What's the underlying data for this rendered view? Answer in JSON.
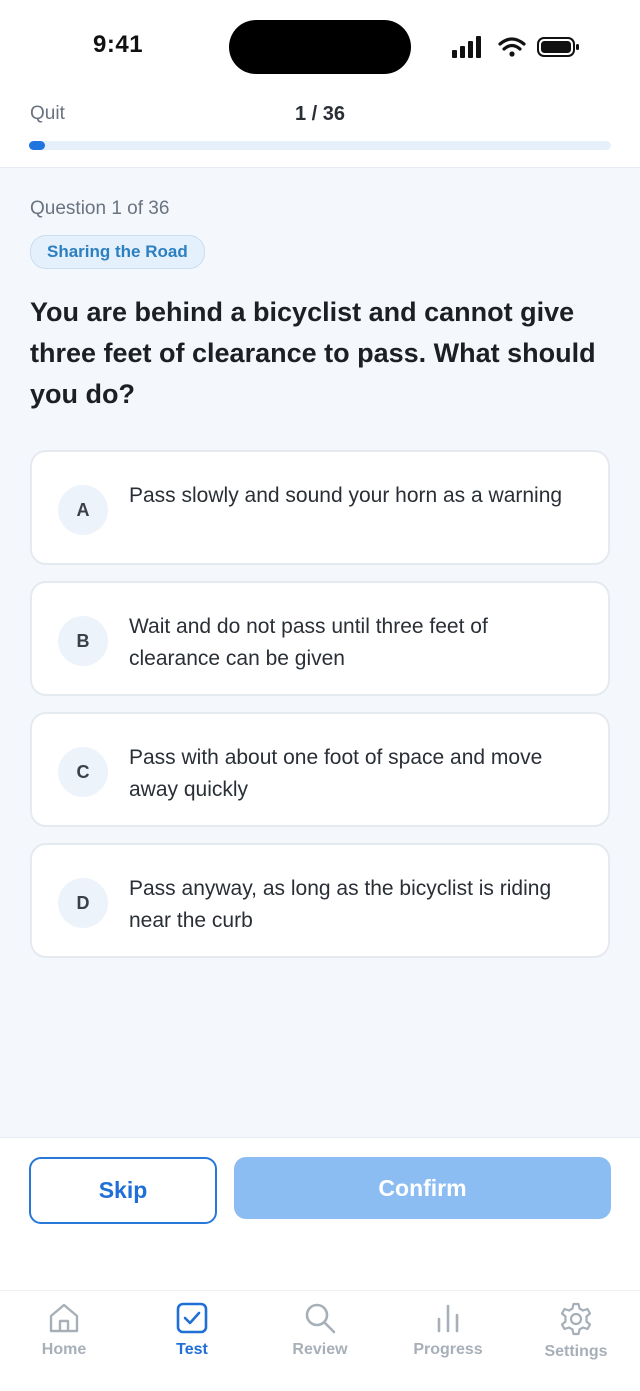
{
  "status_bar": {
    "time": "9:41"
  },
  "header": {
    "quit_label": "Quit",
    "counter": "1 / 36",
    "progress_fraction": 0.028
  },
  "question": {
    "meta": "Question 1 of 36",
    "category": "Sharing the Road",
    "text": "You are behind a bicyclist and cannot give three feet of clearance to pass. What should you do?"
  },
  "options": [
    {
      "letter": "A",
      "text": "Pass slowly and sound your horn as a warning"
    },
    {
      "letter": "B",
      "text": "Wait and do not pass until three feet of clearance can be given"
    },
    {
      "letter": "C",
      "text": "Pass with about one foot of space and move away quickly"
    },
    {
      "letter": "D",
      "text": "Pass anyway, as long as the bicyclist is riding near the curb"
    }
  ],
  "actions": {
    "skip_label": "Skip",
    "confirm_label": "Confirm"
  },
  "tabbar": {
    "items": [
      {
        "label": "Home",
        "icon": "home-icon"
      },
      {
        "label": "Test",
        "icon": "checkbox-icon",
        "active": true
      },
      {
        "label": "Review",
        "icon": "search-icon"
      },
      {
        "label": "Progress",
        "icon": "bar-chart-icon"
      },
      {
        "label": "Settings",
        "icon": "gear-icon"
      }
    ]
  },
  "colors": {
    "accent": "#1F74E0",
    "confirm_disabled": "#8CBDF2",
    "tag_text": "#2C7FC0"
  }
}
